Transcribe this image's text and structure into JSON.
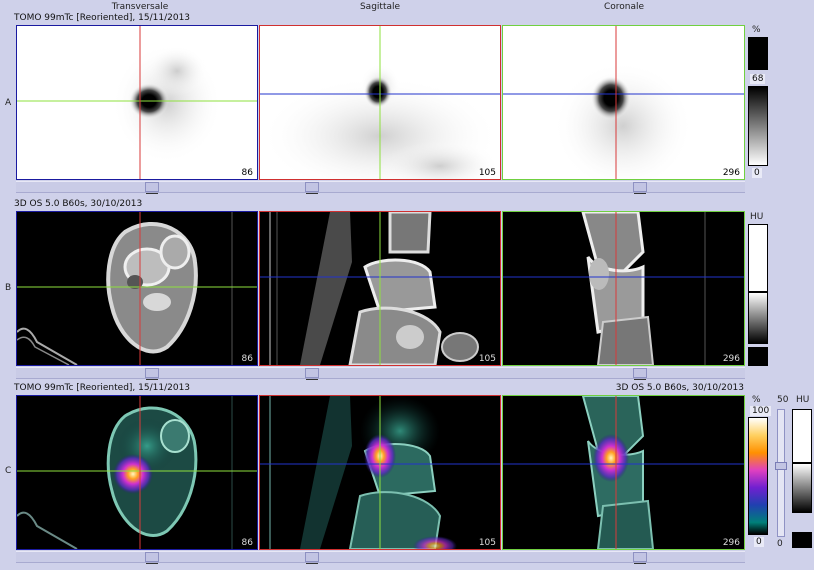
{
  "headers": {
    "transversal": "Transversale",
    "sagittal": "Sagittale",
    "coronal": "Coronale"
  },
  "rows": {
    "a": {
      "label": "A",
      "series": "TOMO 99mTc [Reoriented], 15/11/2013",
      "slices": {
        "transversal": "86",
        "sagittal": "105",
        "coronal": "296"
      },
      "scale": {
        "unit": "%",
        "top": "68",
        "bottom": "0"
      }
    },
    "b": {
      "label": "B",
      "series": "3D  OS  5.0  B60s, 30/10/2013",
      "slices": {
        "transversal": "86",
        "sagittal": "105",
        "coronal": "296"
      },
      "scale": {
        "unit": "HU"
      }
    },
    "c": {
      "label": "C",
      "series_left": "TOMO 99mTc [Reoriented], 15/11/2013",
      "series_right": "3D  OS  5.0  B60s, 30/10/2013",
      "slices": {
        "transversal": "86",
        "sagittal": "105",
        "coronal": "296"
      },
      "scale": {
        "unit": "%",
        "top": "100",
        "bottom": "0",
        "blend_top": "50",
        "blend_bottom": "0",
        "hu_unit": "HU"
      }
    }
  },
  "colors": {
    "transversal_border": "#1a1aa0",
    "sagittal_border": "#d03030",
    "coronal_border": "#70d040",
    "crosshair_h_green": "#8ee03e",
    "crosshair_v_red": "#d83a3a",
    "crosshair_h_blue": "#2233cc"
  }
}
